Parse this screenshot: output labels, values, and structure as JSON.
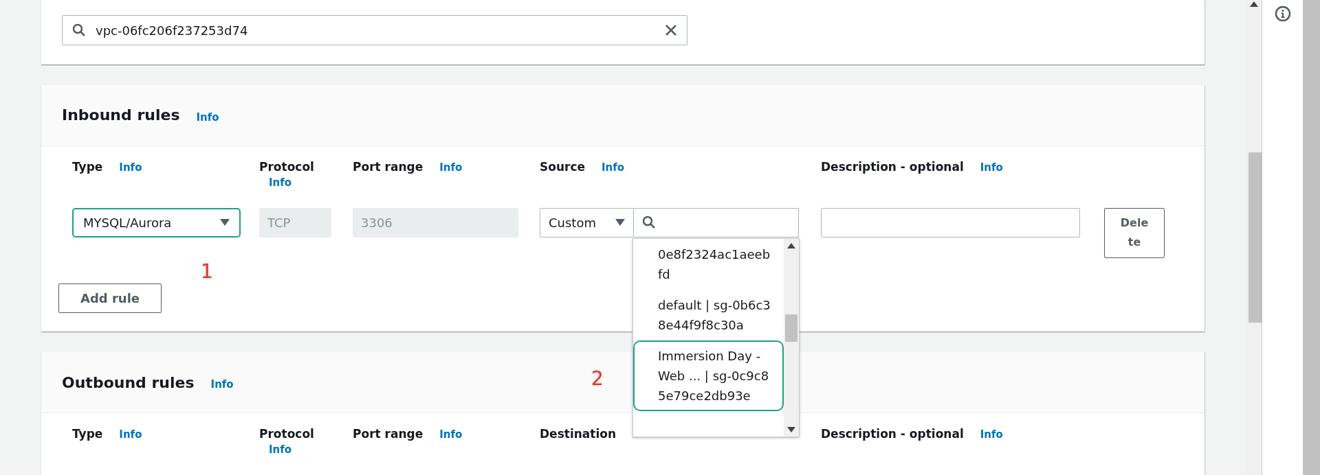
{
  "vpc_filter": {
    "value": "vpc-06fc206f237253d74"
  },
  "inbound": {
    "title": "Inbound rules",
    "info": "Info",
    "annotation": "1",
    "columns": [
      {
        "label": "Type",
        "info": "Info"
      },
      {
        "label": "Protocol",
        "info": "Info"
      },
      {
        "label": "Port range",
        "info": "Info"
      },
      {
        "label": "Source",
        "info": "Info"
      },
      {
        "label": "Description - optional",
        "info": "Info"
      }
    ],
    "rule": {
      "type": "MYSQL/Aurora",
      "type_highlighted": true,
      "protocol": "TCP",
      "port_range": "3306",
      "source_type": "Custom",
      "delete": "Delete"
    },
    "source_options": [
      {
        "text": "0e8f2324ac1aeebfd",
        "highlighted": false
      },
      {
        "text": "default | sg-0b6c38e44f9f8c30a",
        "highlighted": false
      },
      {
        "text": "Immersion Day - Web ... | sg-0c9c85e79ce2db93e",
        "highlighted": true
      }
    ],
    "add_rule": "Add rule"
  },
  "outbound": {
    "title": "Outbound rules",
    "info": "Info",
    "annotation": "2",
    "columns": [
      {
        "label": "Type",
        "info": "Info"
      },
      {
        "label": "Protocol",
        "info": "Info"
      },
      {
        "label": "Port range",
        "info": "Info"
      },
      {
        "label": "Destination"
      },
      {
        "label": "Description - optional",
        "info": "Info"
      }
    ]
  }
}
